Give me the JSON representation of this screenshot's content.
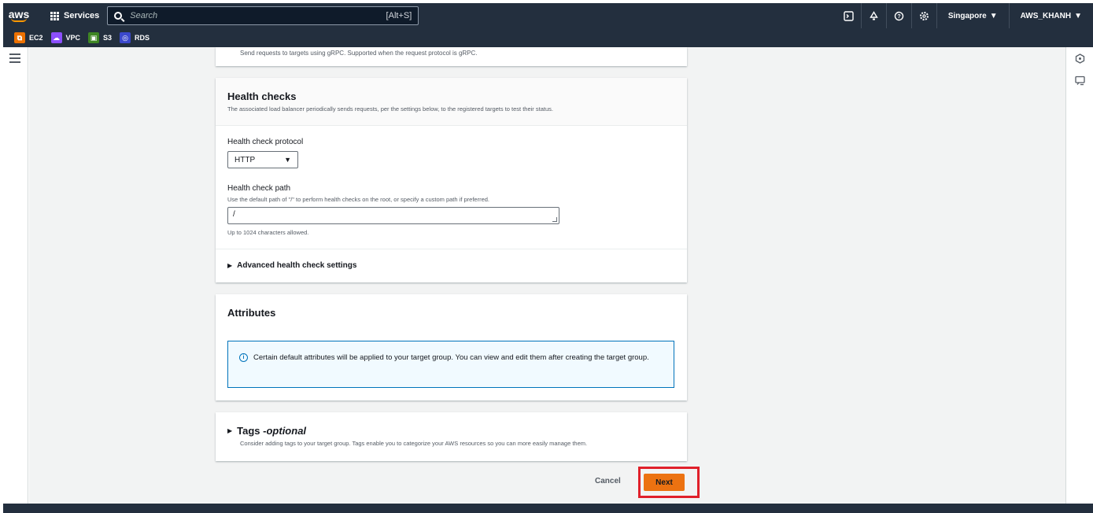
{
  "topnav": {
    "logo": "aws",
    "services_label": "Services",
    "search_placeholder": "Search",
    "search_shortcut": "[Alt+S]",
    "region": "Singapore",
    "account": "AWS_KHANH",
    "region_caret": "▼",
    "account_caret": "▼"
  },
  "favorites": [
    {
      "label": "EC2",
      "color": "#ed7100"
    },
    {
      "label": "VPC",
      "color": "#8c4fff"
    },
    {
      "label": "S3",
      "color": "#3f8624"
    },
    {
      "label": "RDS",
      "color": "#3b48cc"
    }
  ],
  "protocol_version_panel": {
    "note": "Send requests to targets using gRPC. Supported when the request protocol is gRPC."
  },
  "health_checks": {
    "title": "Health checks",
    "description": "The associated load balancer periodically sends requests, per the settings below, to the registered targets to test their status.",
    "protocol_label": "Health check protocol",
    "protocol_value": "HTTP",
    "path_label": "Health check path",
    "path_description": "Use the default path of \"/\" to perform health checks on the root, or specify a custom path if preferred.",
    "path_value": "/",
    "path_constraint": "Up to 1024 characters allowed.",
    "advanced_label": "Advanced health check settings"
  },
  "attributes": {
    "title": "Attributes",
    "info": "Certain default attributes will be applied to your target group. You can view and edit them after creating the target group."
  },
  "tags": {
    "title": "Tags - ",
    "title_optional": "optional",
    "description": "Consider adding tags to your target group. Tags enable you to categorize your AWS resources so you can more easily manage them."
  },
  "footer": {
    "cancel_label": "Cancel",
    "next_label": "Next"
  },
  "colors": {
    "nav_bg": "#232f3e",
    "primary_button": "#ec7211",
    "info_border": "#0073bb",
    "highlight": "#e0202a"
  }
}
